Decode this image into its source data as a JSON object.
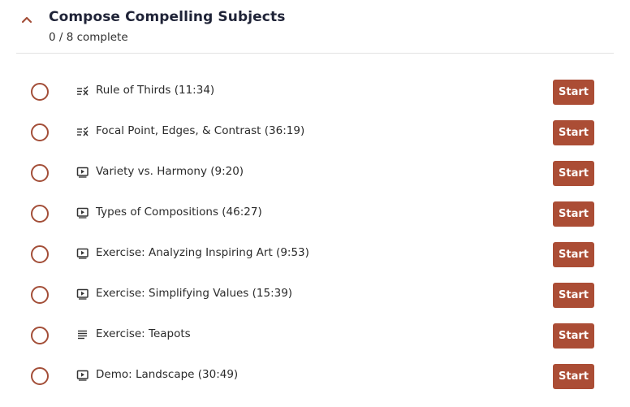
{
  "section": {
    "title": "Compose Compelling Subjects",
    "progress": "0 / 8 complete",
    "expanded": true,
    "toggle_icon": "chevron-up-icon"
  },
  "colors": {
    "accent": "#ab4d35",
    "circle_border": "#a34e38",
    "title": "#1f2337",
    "divider": "#e3e3e3"
  },
  "lessons": [
    {
      "title": "Rule of Thirds (11:34)",
      "type": "quiz",
      "icon": "quiz-icon",
      "status": "incomplete",
      "action": "Start"
    },
    {
      "title": "Focal Point, Edges, & Contrast (36:19)",
      "type": "quiz",
      "icon": "quiz-icon",
      "status": "incomplete",
      "action": "Start"
    },
    {
      "title": "Variety vs. Harmony (9:20)",
      "type": "video",
      "icon": "video-icon",
      "status": "incomplete",
      "action": "Start"
    },
    {
      "title": "Types of Compositions (46:27)",
      "type": "video",
      "icon": "video-icon",
      "status": "incomplete",
      "action": "Start"
    },
    {
      "title": "Exercise: Analyzing Inspiring Art (9:53)",
      "type": "video",
      "icon": "video-icon",
      "status": "incomplete",
      "action": "Start"
    },
    {
      "title": "Exercise: Simplifying Values (15:39)",
      "type": "video",
      "icon": "video-icon",
      "status": "incomplete",
      "action": "Start"
    },
    {
      "title": "Exercise: Teapots",
      "type": "text",
      "icon": "text-lesson-icon",
      "status": "incomplete",
      "action": "Start"
    },
    {
      "title": "Demo: Landscape (30:49)",
      "type": "video",
      "icon": "video-icon",
      "status": "incomplete",
      "action": "Start"
    }
  ]
}
